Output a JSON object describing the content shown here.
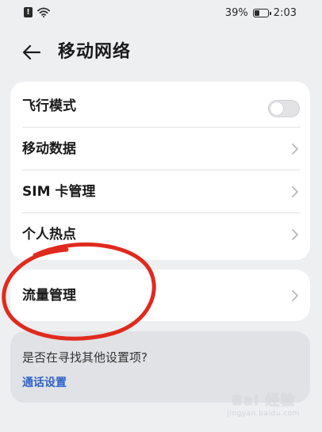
{
  "status_bar": {
    "alert_glyph": "!",
    "battery_percent": "39%",
    "battery_level": 0.39,
    "time": "2:03",
    "icons": [
      "sim-alert-icon",
      "wifi-icon",
      "battery-icon"
    ]
  },
  "header": {
    "back_icon": "arrow-left-icon",
    "title": "移动网络"
  },
  "settings": {
    "airplane_mode": {
      "label": "飞行模式",
      "toggle_on": false
    },
    "mobile_data": {
      "label": "移动数据"
    },
    "sim_management": {
      "label": "SIM 卡管理"
    },
    "hotspot": {
      "label": "个人热点"
    },
    "data_usage": {
      "label": "流量管理"
    }
  },
  "search_suggestion": {
    "hint": "是否在寻找其他设置项?",
    "link": "通话设置"
  },
  "watermark": {
    "main": "Bai 经验",
    "sub": "jingyan.baidu.com"
  },
  "colors": {
    "background": "#eeeff1",
    "card": "#ffffff",
    "link": "#2f63c9",
    "annotation": "#e02a1e"
  }
}
